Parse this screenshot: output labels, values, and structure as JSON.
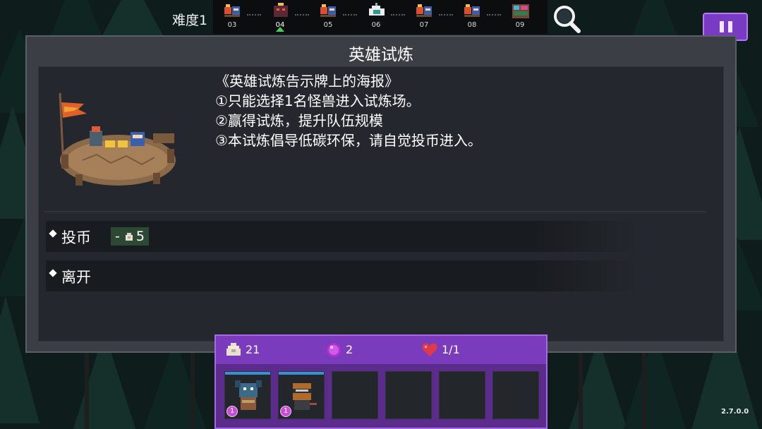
{
  "top_bar": {
    "difficulty_label": "难度1",
    "stages": [
      {
        "number": "03",
        "current": false
      },
      {
        "number": "04",
        "current": true
      },
      {
        "number": "05",
        "current": false
      },
      {
        "number": "06",
        "current": false
      },
      {
        "number": "07",
        "current": false
      },
      {
        "number": "08",
        "current": false
      },
      {
        "number": "09",
        "current": false
      }
    ],
    "search_icon": "magnifier-icon",
    "pause_icon": "pause-icon"
  },
  "dialog": {
    "title": "英雄试炼",
    "poster_lines": [
      "《英雄试炼告示牌上的海报》",
      "①只能选择1名怪兽进入试炼场。",
      "②赢得试炼，提升队伍规模",
      "③本试炼倡导低碳环保，请自觉投币进入。"
    ],
    "options": [
      {
        "label": "投币",
        "cost_prefix": "-",
        "cost_value": "5",
        "cost_icon": "coin-pouch-icon"
      },
      {
        "label": "离开"
      }
    ]
  },
  "inventory": {
    "coins": "21",
    "gems": "2",
    "hearts": "1/1",
    "slots": [
      {
        "filled": true,
        "level": "1",
        "monster": "blue-beast"
      },
      {
        "filled": true,
        "level": "1",
        "monster": "masked-fighter"
      },
      {
        "filled": false
      },
      {
        "filled": false
      },
      {
        "filled": false
      },
      {
        "filled": false
      }
    ]
  },
  "version": "2.7.0.0",
  "colors": {
    "panel_purple": "#7b3bbd",
    "dialog_bg": "#3b3f45",
    "cost_bg": "#2c4a33",
    "current_marker": "#43d04a"
  }
}
